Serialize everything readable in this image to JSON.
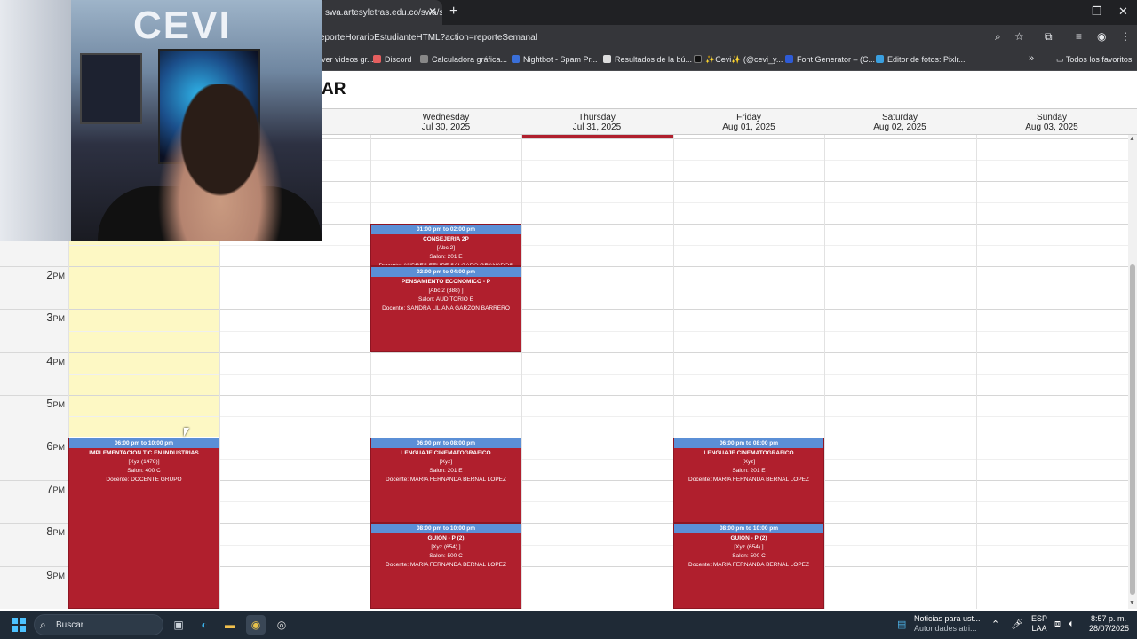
{
  "browser": {
    "tab_title": "swa.artesyletras.edu.co/swa/se",
    "url": "eporteHorarioEstudianteHTML?action=reporteSemanal",
    "bookmarks": [
      {
        "label": "ver videos gr...",
        "color": "#cc3333"
      },
      {
        "label": "Discord",
        "color": "#e55f5f"
      },
      {
        "label": "Calculadora gráfica...",
        "color": "#888888"
      },
      {
        "label": "Nightbot - Spam Pr...",
        "color": "#3a6fd8"
      },
      {
        "label": "Resultados de la bú...",
        "color": "#dddddd"
      },
      {
        "label": "✨Cevi✨ (@cevi_y...",
        "color": "#111111"
      },
      {
        "label": "Font Generator – (C...",
        "color": "#2e5bd6"
      },
      {
        "label": "Editor de fotos: Pixlr...",
        "color": "#3aa0e0"
      }
    ],
    "bookmarks_more": "»",
    "all_favorites": "Todos los favoritos"
  },
  "page": {
    "title_fragment": "AR"
  },
  "days": [
    {
      "name": "Wednesday",
      "date": "Jul 30, 2025"
    },
    {
      "name": "Thursday",
      "date": "Jul 31, 2025"
    },
    {
      "name": "Friday",
      "date": "Aug 01, 2025"
    },
    {
      "name": "Saturday",
      "date": "Aug 02, 2025"
    },
    {
      "name": "Sunday",
      "date": "Aug 03, 2025"
    }
  ],
  "hours": [
    {
      "num": "2",
      "suffix": "PM"
    },
    {
      "num": "3",
      "suffix": "PM"
    },
    {
      "num": "4",
      "suffix": "PM"
    },
    {
      "num": "5",
      "suffix": "PM"
    },
    {
      "num": "6",
      "suffix": "PM"
    },
    {
      "num": "7",
      "suffix": "PM"
    },
    {
      "num": "8",
      "suffix": "PM"
    },
    {
      "num": "9",
      "suffix": "PM"
    }
  ],
  "events": [
    {
      "time": "01:00 pm to 02:00 pm",
      "title": "CONSEJERIA 2P",
      "group": "[Abc 2]",
      "room": "Salon: 201 E",
      "teacher": "Docente: ANDRES FELIPE SALGADO GRANADOS",
      "day": 1,
      "start": 13,
      "end": 14
    },
    {
      "time": "02:00 pm to 04:00 pm",
      "title": "PENSAMIENTO ECONOMICO - P",
      "group": "[Abc 2 (388) ]",
      "room": "Salon: AUDITORIO E",
      "teacher": "Docente: SANDRA LILIANA GARZON BARRERO",
      "day": 1,
      "start": 14,
      "end": 16
    },
    {
      "time": "06:00 pm to 10:00 pm",
      "title": "IMPLEMENTACION TIC EN INDUSTRIAS",
      "group": "[Xyz (1478)]",
      "room": "Salon: 400 C",
      "teacher": "Docente: DOCENTE GRUPO",
      "day": -1,
      "start": 18,
      "end": 22
    },
    {
      "time": "06:00 pm to 08:00 pm",
      "title": "LENGUAJE CINEMATOGRAFICO",
      "group": "[Xyz]",
      "room": "Salon: 201 E",
      "teacher": "Docente: MARIA FERNANDA BERNAL LOPEZ",
      "day": 1,
      "start": 18,
      "end": 20
    },
    {
      "time": "06:00 pm to 08:00 pm",
      "title": "LENGUAJE CINEMATOGRAFICO",
      "group": "[Xyz]",
      "room": "Salon: 201 E",
      "teacher": "Docente: MARIA FERNANDA BERNAL LOPEZ",
      "day": 3,
      "start": 18,
      "end": 20
    },
    {
      "time": "08:00 pm to 10:00 pm",
      "title": "GUION - P (2)",
      "group": "[Xyz (654) ]",
      "room": "Salon: 500 C",
      "teacher": "Docente: MARIA FERNANDA BERNAL LOPEZ",
      "day": 1,
      "start": 20,
      "end": 22
    },
    {
      "time": "08:00 pm to 10:00 pm",
      "title": "GUION - P (2)",
      "group": "[Xyz (654) ]",
      "room": "Salon: 500 C",
      "teacher": "Docente: MARIA FERNANDA BERNAL LOPEZ",
      "day": 3,
      "start": 20,
      "end": 22
    }
  ],
  "taskbar": {
    "search_placeholder": "Buscar",
    "news_title": "Noticias para ust...",
    "news_sub": "Autoridades atri...",
    "lang_top": "ESP",
    "lang_bottom": "LAA",
    "time": "8:57 p. m.",
    "date": "28/07/2025"
  },
  "colors": {
    "event": "#b01f2d",
    "event_header": "#5b8fd6",
    "today_column": "#fdf8c4"
  },
  "icons": [
    "search-icon",
    "star-icon",
    "extensions-icon",
    "profile-icon",
    "menu-icon",
    "folder-icon",
    "windows-start-icon",
    "edge-icon",
    "explorer-icon",
    "chrome-icon",
    "obs-icon"
  ]
}
